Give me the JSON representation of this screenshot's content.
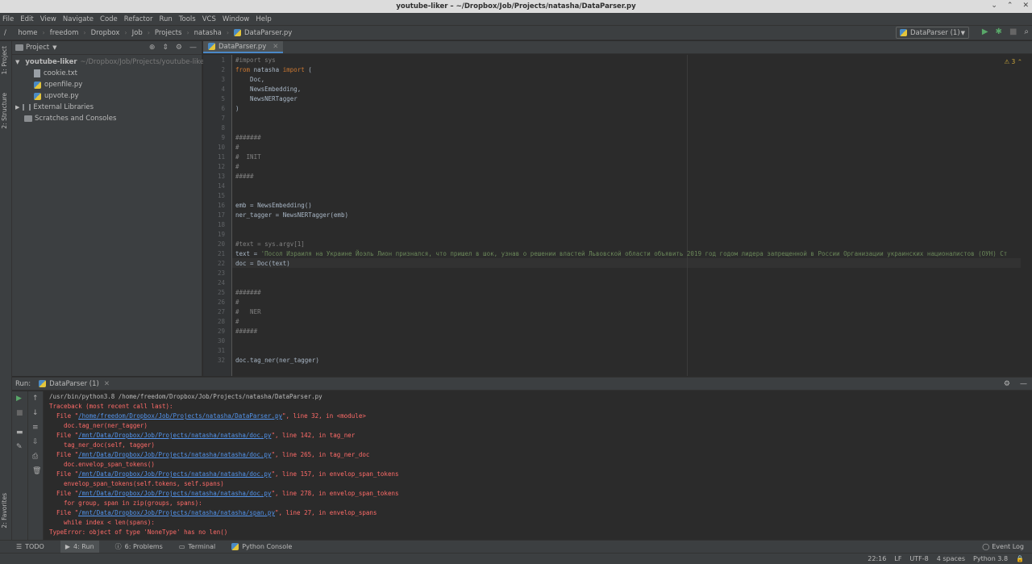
{
  "window": {
    "title": "youtube-liker – ~/Dropbox/Job/Projects/natasha/DataParser.py"
  },
  "menu": [
    "File",
    "Edit",
    "View",
    "Navigate",
    "Code",
    "Refactor",
    "Run",
    "Tools",
    "VCS",
    "Window",
    "Help"
  ],
  "breadcrumb": [
    "/",
    "home",
    "freedom",
    "Dropbox",
    "Job",
    "Projects",
    "natasha",
    "DataParser.py"
  ],
  "run_config": "DataParser (1)",
  "project_panel": {
    "title": "Project",
    "root": {
      "name": "youtube-liker",
      "path": "~/Dropbox/Job/Projects/youtube-liker"
    },
    "files": [
      "cookie.txt",
      "openfile.py",
      "upvote.py"
    ],
    "external": "External Libraries",
    "scratches": "Scratches and Consoles"
  },
  "left_tabs": {
    "project": "1: Project",
    "structure": "2: Structure",
    "favorites": "2: Favorites"
  },
  "editor": {
    "tab": "DataParser.py",
    "warnings": "3",
    "lines": [
      {
        "n": "1",
        "t": "#import sys",
        "c": "cm"
      },
      {
        "n": "2",
        "t": "from natasha import (",
        "c": "mix1"
      },
      {
        "n": "3",
        "t": "    Doc,",
        "c": ""
      },
      {
        "n": "4",
        "t": "    NewsEmbedding,",
        "c": ""
      },
      {
        "n": "5",
        "t": "    NewsNERTagger",
        "c": ""
      },
      {
        "n": "6",
        "t": ")",
        "c": ""
      },
      {
        "n": "7",
        "t": "",
        "c": ""
      },
      {
        "n": "8",
        "t": "",
        "c": ""
      },
      {
        "n": "9",
        "t": "#######",
        "c": "cm"
      },
      {
        "n": "10",
        "t": "#",
        "c": "cm"
      },
      {
        "n": "11",
        "t": "#  INIT",
        "c": "cm"
      },
      {
        "n": "12",
        "t": "#",
        "c": "cm"
      },
      {
        "n": "13",
        "t": "#####",
        "c": "cm"
      },
      {
        "n": "14",
        "t": "",
        "c": ""
      },
      {
        "n": "15",
        "t": "",
        "c": ""
      },
      {
        "n": "16",
        "t": "emb = NewsEmbedding()",
        "c": ""
      },
      {
        "n": "17",
        "t": "ner_tagger = NewsNERTagger(emb)",
        "c": ""
      },
      {
        "n": "18",
        "t": "",
        "c": ""
      },
      {
        "n": "19",
        "t": "",
        "c": ""
      },
      {
        "n": "20",
        "t": "#text = sys.argv[1]",
        "c": "cm"
      },
      {
        "n": "21",
        "t": "text = 'Посол Израиля на Украине Йоэль Лион признался, что пришел в шок, узнав о решении властей Львовской области объявить 2019 год годом лидера запрещенной в России Организации украинских националистов (ОУН) Ст",
        "c": "mix2"
      },
      {
        "n": "22",
        "t": "doc = Doc(text)",
        "c": ""
      },
      {
        "n": "23",
        "t": "",
        "c": ""
      },
      {
        "n": "24",
        "t": "",
        "c": ""
      },
      {
        "n": "25",
        "t": "#######",
        "c": "cm"
      },
      {
        "n": "26",
        "t": "#",
        "c": "cm"
      },
      {
        "n": "27",
        "t": "#   NER",
        "c": "cm"
      },
      {
        "n": "28",
        "t": "#",
        "c": "cm"
      },
      {
        "n": "29",
        "t": "######",
        "c": "cm"
      },
      {
        "n": "30",
        "t": "",
        "c": ""
      },
      {
        "n": "31",
        "t": "",
        "c": ""
      },
      {
        "n": "32",
        "t": "doc.tag_ner(ner_tagger)",
        "c": ""
      }
    ]
  },
  "run_panel": {
    "label": "Run:",
    "tab": "DataParser (1)",
    "output": [
      {
        "t": "/usr/bin/python3.8 /home/freedom/Dropbox/Job/Projects/natasha/DataParser.py",
        "plain": true
      },
      {
        "t": "Traceback (most recent call last):"
      },
      {
        "pre": "  File \"",
        "link": "/home/freedom/Dropbox/Job/Projects/natasha/DataParser.py",
        "post": "\", line 32, in <module>"
      },
      {
        "t": "    doc.tag_ner(ner_tagger)"
      },
      {
        "pre": "  File \"",
        "link": "/mnt/Data/Dropbox/Job/Projects/natasha/natasha/doc.py",
        "post": "\", line 142, in tag_ner"
      },
      {
        "t": "    tag_ner_doc(self, tagger)"
      },
      {
        "pre": "  File \"",
        "link": "/mnt/Data/Dropbox/Job/Projects/natasha/natasha/doc.py",
        "post": "\", line 265, in tag_ner_doc"
      },
      {
        "t": "    doc.envelop_span_tokens()"
      },
      {
        "pre": "  File \"",
        "link": "/mnt/Data/Dropbox/Job/Projects/natasha/natasha/doc.py",
        "post": "\", line 157, in envelop_span_tokens"
      },
      {
        "t": "    envelop_span_tokens(self.tokens, self.spans)"
      },
      {
        "pre": "  File \"",
        "link": "/mnt/Data/Dropbox/Job/Projects/natasha/natasha/doc.py",
        "post": "\", line 278, in envelop_span_tokens"
      },
      {
        "t": "    for group, span in zip(groups, spans):"
      },
      {
        "pre": "  File \"",
        "link": "/mnt/Data/Dropbox/Job/Projects/natasha/natasha/span.py",
        "post": "\", line 27, in envelop_spans"
      },
      {
        "t": "    while index < len(spans):"
      },
      {
        "t": "TypeError: object of type 'NoneType' has no len()"
      }
    ]
  },
  "bottom_tabs": [
    "TODO",
    "4: Run",
    "6: Problems",
    "Terminal",
    "Python Console"
  ],
  "event_log": "Event Log",
  "status": {
    "position": "22:16",
    "line_sep": "LF",
    "encoding": "UTF-8",
    "indent": "4 spaces",
    "interpreter": "Python 3.8"
  }
}
